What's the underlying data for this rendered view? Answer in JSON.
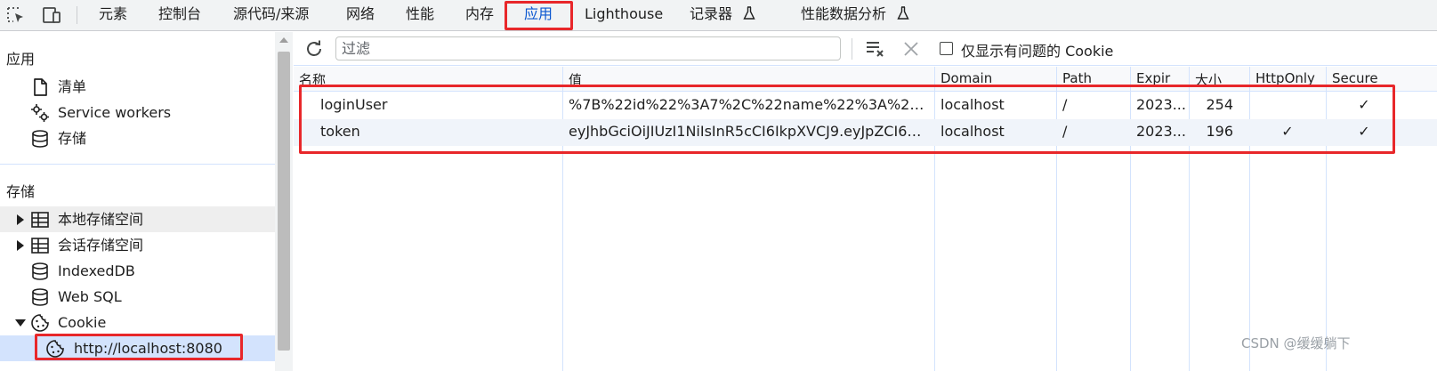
{
  "toolbar": {
    "tabs": [
      "元素",
      "控制台",
      "源代码/来源",
      "网络",
      "性能",
      "内存",
      "应用",
      "Lighthouse",
      "记录器",
      "性能数据分析"
    ],
    "active_tab": "应用"
  },
  "sidebar": {
    "app_section_title": "应用",
    "app_items": [
      "清单",
      "Service workers",
      "存储"
    ],
    "storage_section_title": "存储",
    "storage_items": [
      "本地存储空间",
      "会话存储空间",
      "IndexedDB",
      "Web SQL",
      "Cookie"
    ],
    "cookie_child": "http://localhost:8080"
  },
  "filter": {
    "placeholder": "过滤",
    "only_issues_label": "仅显示有问题的 Cookie"
  },
  "table": {
    "headers": [
      "名称",
      "值",
      "Domain",
      "Path",
      "Expir",
      "大小",
      "HttpOnly",
      "Secure"
    ],
    "rows": [
      {
        "name": "loginUser",
        "value": "%7B%22id%22%3A7%2C%22name%22%3A%22ad...",
        "domain": "localhost",
        "path": "/",
        "expires": "2023...",
        "size": "254",
        "httponly": "",
        "secure": "✓"
      },
      {
        "name": "token",
        "value": "eyJhbGciOiJIUzI1NiIsInR5cCI6IkpXVCJ9.eyJpZCI6Ny...",
        "domain": "localhost",
        "path": "/",
        "expires": "2023...",
        "size": "196",
        "httponly": "✓",
        "secure": "✓"
      }
    ]
  },
  "watermark": "CSDN @缓缓躺下",
  "colors": {
    "accent": "#0b57d0",
    "highlight_box": "#e8272a"
  }
}
